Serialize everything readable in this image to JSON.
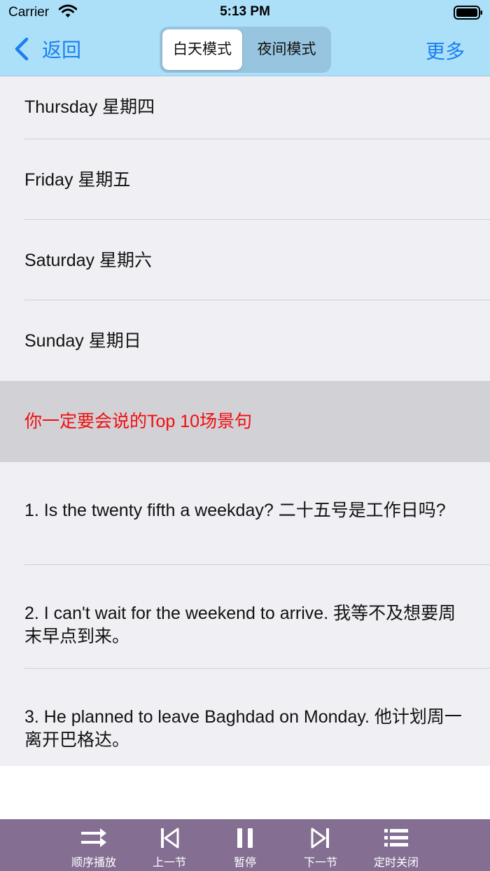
{
  "status_bar": {
    "carrier": "Carrier",
    "time": "5:13 PM",
    "icons": [
      "wifi-icon",
      "battery-icon"
    ]
  },
  "nav": {
    "back_label": "返回",
    "segments": [
      "白天模式",
      "夜间模式"
    ],
    "selected_segment": "白天模式",
    "more_label": "更多"
  },
  "list": {
    "rows": [
      {
        "text": "Thursday 星期四",
        "type": "item"
      },
      {
        "text": "Friday 星期五",
        "type": "item"
      },
      {
        "text": "Saturday 星期六",
        "type": "item"
      },
      {
        "text": "Sunday 星期日",
        "type": "item"
      },
      {
        "text": "你一定要会说的Top 10场景句",
        "type": "header"
      },
      {
        "text": "1. Is the twenty fifth a weekday? 二十五号是工作日吗?",
        "type": "item"
      },
      {
        "text": "2. I can't wait for the weekend to arrive. 我等不及想要周末早点到来。",
        "type": "item"
      },
      {
        "text": "3. He planned to leave Baghdad on Monday. 他计划周一离开巴格达。",
        "type": "item"
      }
    ]
  },
  "toolbar": {
    "items": [
      {
        "label": "顺序播放",
        "icon": "shuffle-icon"
      },
      {
        "label": "上一节",
        "icon": "previous-icon"
      },
      {
        "label": "暂停",
        "icon": "pause-icon"
      },
      {
        "label": "下一节",
        "icon": "next-icon"
      },
      {
        "label": "定时关闭",
        "icon": "timer-list-icon"
      }
    ]
  },
  "colors": {
    "nav_background": "#ace0f9",
    "accent": "#1a7ff0",
    "section_header_text": "#f20d0d",
    "section_header_background": "#d1d1d6",
    "row_background": "#f0f0f4",
    "toolbar_background": "#846f93"
  }
}
